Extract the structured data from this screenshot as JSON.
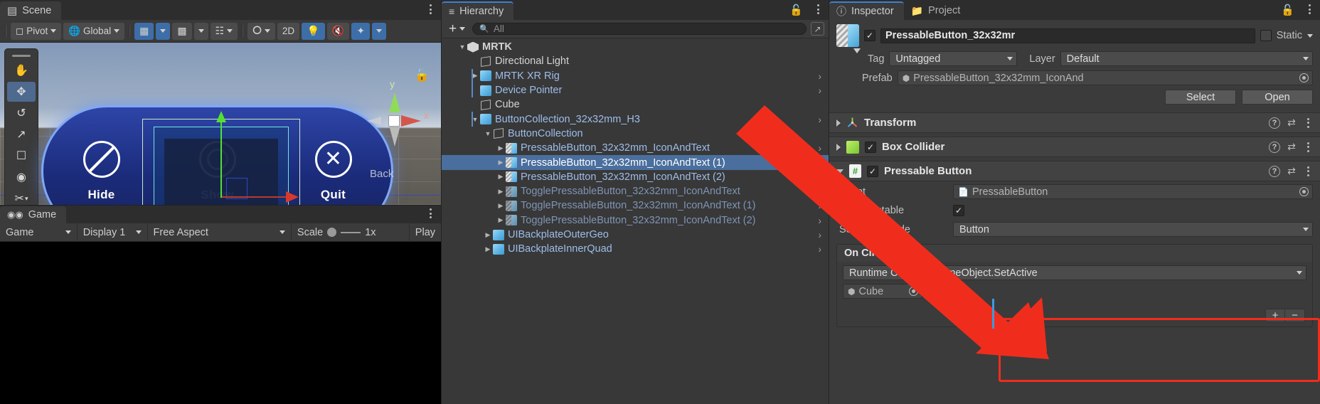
{
  "scene_panel": {
    "tab_label": "Scene",
    "tab_icon": "grid-icon",
    "toolbar": {
      "pivot": "Pivot",
      "global": "Global",
      "grid_icon": "grid-snap-icon",
      "magnet_icon": "magnet-snap-icon",
      "ruler_icon": "ruler-icon",
      "shading_icon": "draw-mode-icon",
      "twod": "2D",
      "light_icon": "lighting-icon",
      "audio_icon": "audio-mute-icon",
      "fx_icon": "effects-icon"
    },
    "side_tools": [
      "hand-tool",
      "move-tool",
      "rotate-tool",
      "scale-tool",
      "rect-tool",
      "transform-tool",
      "custom-tool",
      "snap-tool"
    ],
    "gizmo": {
      "y_label": "y",
      "x_label": "x",
      "lock_icon": "lock-icon"
    },
    "buttons": [
      {
        "label": "Hide",
        "icon": "no-entry-icon"
      },
      {
        "label": "Show",
        "icon": "circle-dot-icon"
      },
      {
        "label": "Quit",
        "icon": "x-circle-icon"
      }
    ],
    "back_label": "Back"
  },
  "game_panel": {
    "tab_label": "Game",
    "tab_icon": "game-controller-icon",
    "toolbar": {
      "mode": "Game",
      "display": "Display 1",
      "aspect": "Free Aspect",
      "scale_label": "Scale",
      "scale_value": "1x",
      "play_label": "Play"
    }
  },
  "hierarchy": {
    "tab_label": "Hierarchy",
    "tab_icon": "hierarchy-list-icon",
    "add_label": "+",
    "search_placeholder": "All",
    "search_icon": "search-icon",
    "expand_icon": "open-in-new-icon",
    "lock_icon": "lock-open-icon",
    "items": [
      {
        "label": "MRTK",
        "depth": 0,
        "icon": "unity-scene-icon",
        "expanded": true,
        "style": "white",
        "bold": true,
        "chevron": false,
        "bar": false
      },
      {
        "label": "Directional Light",
        "depth": 1,
        "icon": "white-cube",
        "expanded": null,
        "style": "white",
        "chevron": false,
        "bar": false
      },
      {
        "label": "MRTK XR Rig",
        "depth": 1,
        "icon": "blue-cube",
        "expanded": false,
        "style": "blue",
        "chevron": true,
        "bar": true
      },
      {
        "label": "Device Pointer",
        "depth": 1,
        "icon": "blue-cube",
        "expanded": null,
        "style": "blue",
        "chevron": true,
        "bar": true
      },
      {
        "label": "Cube",
        "depth": 1,
        "icon": "white-cube",
        "expanded": null,
        "style": "white",
        "chevron": false,
        "bar": false
      },
      {
        "label": "ButtonCollection_32x32mm_H3",
        "depth": 1,
        "icon": "blue-cube",
        "expanded": true,
        "style": "blue",
        "chevron": true,
        "bar": true
      },
      {
        "label": "ButtonCollection",
        "depth": 2,
        "icon": "white-cube",
        "expanded": true,
        "style": "blue",
        "chevron": false,
        "bar": false
      },
      {
        "label": "PressableButton_32x32mm_IconAndText",
        "depth": 3,
        "icon": "prefab-cube",
        "expanded": false,
        "style": "blue",
        "chevron": true,
        "bar": false
      },
      {
        "label": "PressableButton_32x32mm_IconAndText (1)",
        "depth": 3,
        "icon": "prefab-cube",
        "expanded": false,
        "style": "selected",
        "chevron": true,
        "bar": false,
        "selected": true
      },
      {
        "label": "PressableButton_32x32mm_IconAndText (2)",
        "depth": 3,
        "icon": "prefab-cube",
        "expanded": false,
        "style": "blue",
        "chevron": true,
        "bar": false
      },
      {
        "label": "TogglePressableButton_32x32mm_IconAndText",
        "depth": 3,
        "icon": "prefab-dim",
        "expanded": false,
        "style": "dim",
        "chevron": true,
        "bar": false
      },
      {
        "label": "TogglePressableButton_32x32mm_IconAndText (1)",
        "depth": 3,
        "icon": "prefab-dim",
        "expanded": false,
        "style": "dim",
        "chevron": true,
        "bar": false
      },
      {
        "label": "TogglePressableButton_32x32mm_IconAndText (2)",
        "depth": 3,
        "icon": "prefab-dim",
        "expanded": false,
        "style": "dim",
        "chevron": true,
        "bar": false
      },
      {
        "label": "UIBackplateOuterGeo",
        "depth": 2,
        "icon": "blue-cube",
        "expanded": false,
        "style": "blue",
        "chevron": true,
        "bar": false
      },
      {
        "label": "UIBackplateInnerQuad",
        "depth": 2,
        "icon": "blue-cube",
        "expanded": false,
        "style": "blue",
        "chevron": true,
        "bar": false
      }
    ]
  },
  "inspector": {
    "tab_label": "Inspector",
    "tab_icon": "info-icon",
    "project_tab_label": "Project",
    "project_tab_icon": "folder-icon",
    "lock_icon": "lock-open-icon",
    "object_name": "PressableButton_32x32mr",
    "object_enabled": true,
    "static_label": "Static",
    "static_checked": false,
    "tag_label": "Tag",
    "tag_value": "Untagged",
    "layer_label": "Layer",
    "layer_value": "Default",
    "prefab_label": "Prefab",
    "prefab_value": "PressableButton_32x32mm_IconAnd",
    "select_label": "Select",
    "open_label": "Open",
    "components": [
      {
        "name": "Transform",
        "icon": "transform-icon",
        "expanded": false,
        "has_checkbox": false
      },
      {
        "name": "Box Collider",
        "icon": "green-cube-icon",
        "expanded": false,
        "has_checkbox": true,
        "checked": true
      },
      {
        "name": "Pressable Button",
        "icon": "script-icon",
        "expanded": true,
        "has_checkbox": true,
        "checked": true
      }
    ],
    "pressable_button": {
      "script_label": "Script",
      "script_value": "PressableButton",
      "is_interactable_label": "Is Interactable",
      "is_interactable_checked": true,
      "selection_mode_label": "Selection Mode",
      "selection_mode_value": "Button"
    },
    "on_clicked": {
      "header": "On Clicked ()",
      "runtime_value": "Runtime C",
      "function_value": "GameObject.SetActive",
      "target_object": "Cube",
      "arg_checked": true,
      "add_label": "+",
      "remove_label": "−"
    }
  },
  "colors": {
    "accent_red": "#f02d1d",
    "selection_blue": "#4a6f9e",
    "tab_accent": "#3f7fd0",
    "panel_bg": "#383838",
    "inspector_bg": "#3b3b3b"
  }
}
